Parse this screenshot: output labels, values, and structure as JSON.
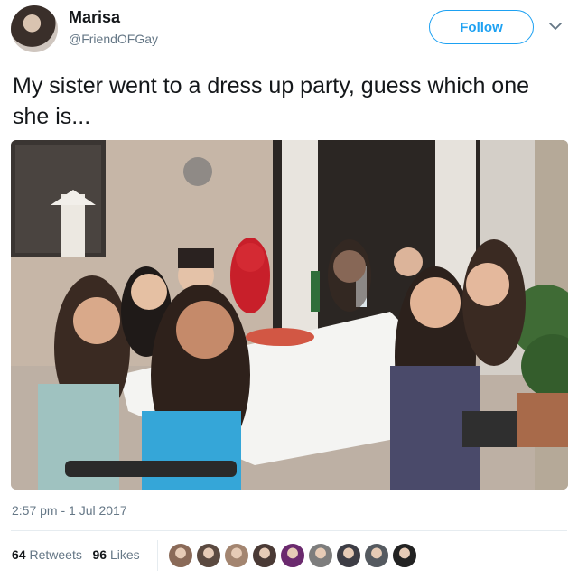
{
  "tweet": {
    "user_name": "Marisa",
    "user_handle": "@FriendOFGay",
    "follow_label": "Follow",
    "text": "My sister went to a dress up party, guess which one she is...",
    "timestamp": "2:57 pm - 1 Jul 2017",
    "retweets_count": "64",
    "retweets_label": "Retweets",
    "likes_count": "96",
    "likes_label": "Likes"
  },
  "likers": [
    {
      "icon": "avatar",
      "color": "#8a6a58"
    },
    {
      "icon": "avatar",
      "color": "#5b4a40"
    },
    {
      "icon": "avatar",
      "color": "#a38570"
    },
    {
      "icon": "avatar",
      "color": "#4a3a35"
    },
    {
      "icon": "avatar",
      "color": "#6b2a6e"
    },
    {
      "icon": "avatar",
      "color": "#7d7d7d"
    },
    {
      "icon": "avatar",
      "color": "#3d3d45"
    },
    {
      "icon": "avatar",
      "color": "#555a60"
    },
    {
      "icon": "avatar",
      "color": "#222222"
    }
  ],
  "colors": {
    "accent": "#1da1f2",
    "text_primary": "#14171a",
    "text_secondary": "#657786"
  }
}
